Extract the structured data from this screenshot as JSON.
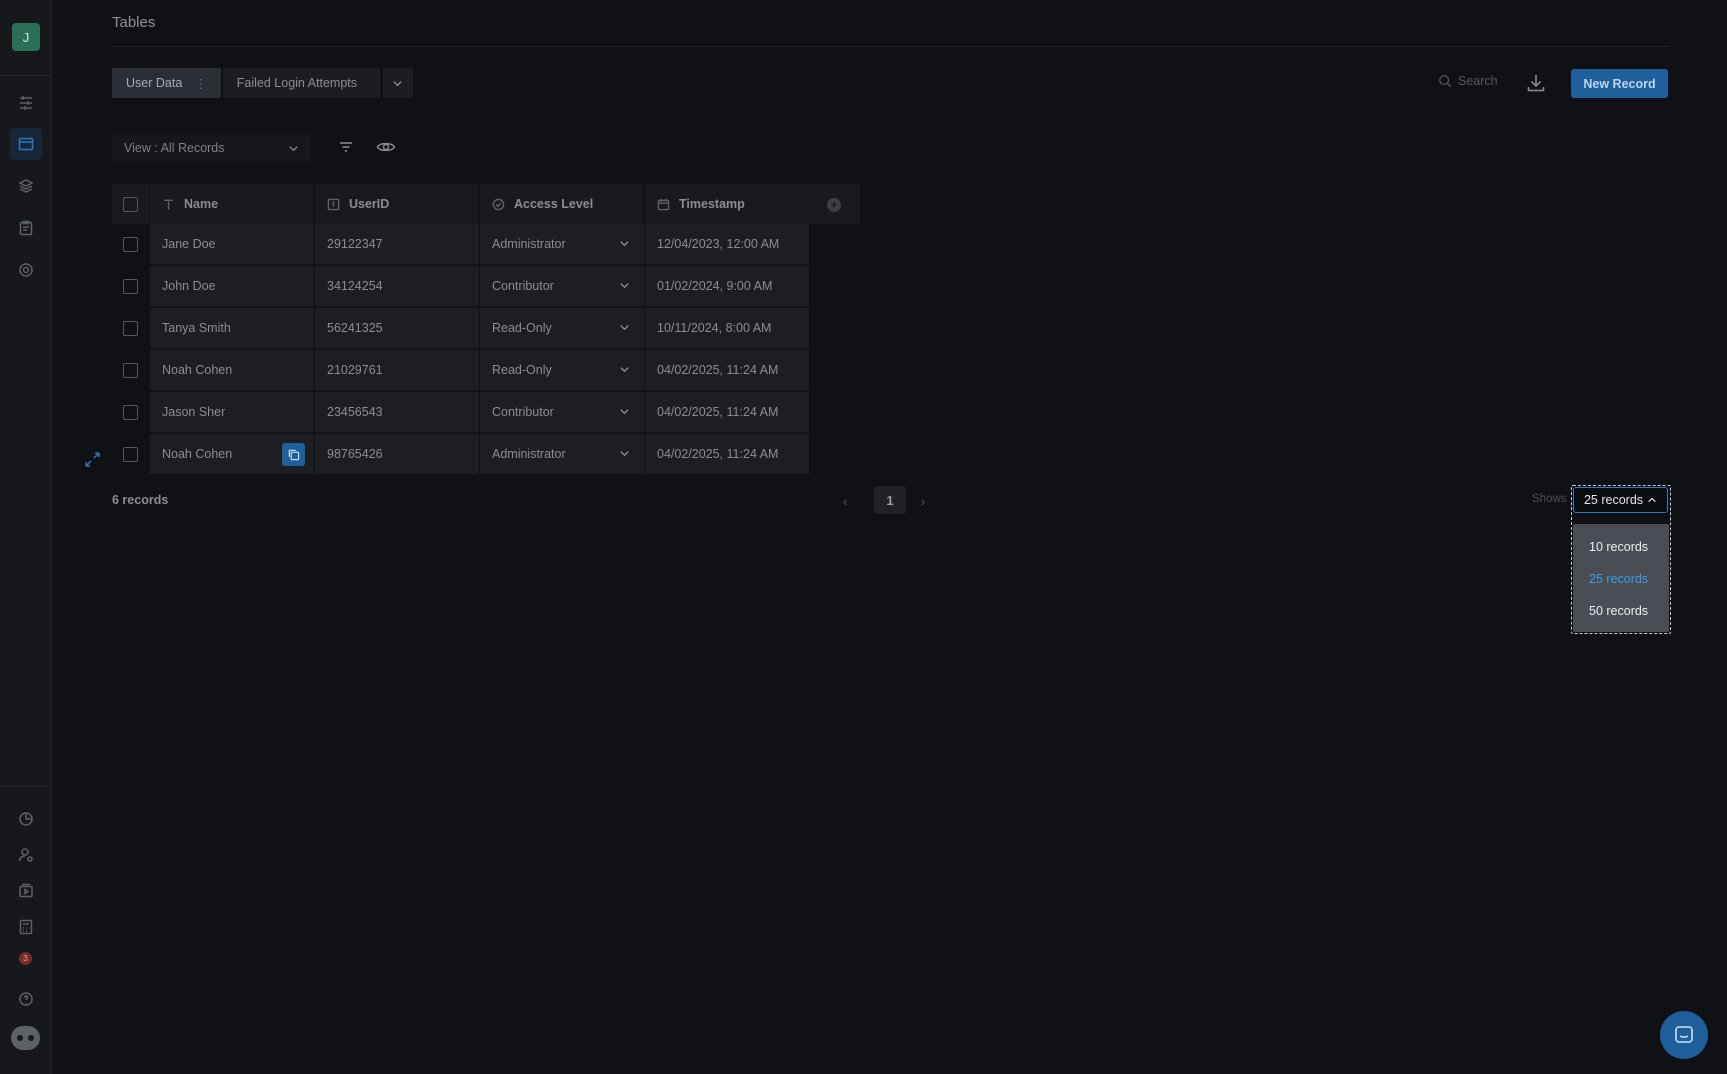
{
  "user": {
    "avatar_initial": "J",
    "notification_count": "3"
  },
  "page": {
    "title": "Tables"
  },
  "tabs": [
    {
      "label": "User Data",
      "active": true
    },
    {
      "label": "Failed Login Attempts",
      "active": false
    }
  ],
  "toolbar": {
    "search_placeholder": "Search",
    "new_record_label": "New Record"
  },
  "view": {
    "label": "View : All Records"
  },
  "table": {
    "columns": [
      "Name",
      "UserID",
      "Access Level",
      "Timestamp"
    ],
    "rows": [
      {
        "name": "Jane Doe",
        "userid": "29122347",
        "access": "Administrator",
        "timestamp": "12/04/2023, 12:00 AM"
      },
      {
        "name": "John Doe",
        "userid": "34124254",
        "access": "Contributor",
        "timestamp": "01/02/2024, 9:00 AM"
      },
      {
        "name": "Tanya Smith",
        "userid": "56241325",
        "access": "Read-Only",
        "timestamp": "10/11/2024, 8:00 AM"
      },
      {
        "name": "Noah Cohen",
        "userid": "21029761",
        "access": "Read-Only",
        "timestamp": "04/02/2025, 11:24 AM"
      },
      {
        "name": "Jason Sher",
        "userid": "23456543",
        "access": "Contributor",
        "timestamp": "04/02/2025, 11:24 AM"
      },
      {
        "name": "Noah Cohen",
        "userid": "98765426",
        "access": "Administrator",
        "timestamp": "04/02/2025, 11:24 AM"
      }
    ]
  },
  "footer": {
    "record_count": "6 records",
    "current_page": "1",
    "shows_label": "Shows",
    "per_page_value": "25 records",
    "per_page_options": [
      "10 records",
      "25 records",
      "50 records"
    ],
    "selected_option": "25 records"
  },
  "colors": {
    "accent": "#1e5f9c",
    "selected_option": "#3b9fe8",
    "background": "#0f1114"
  }
}
